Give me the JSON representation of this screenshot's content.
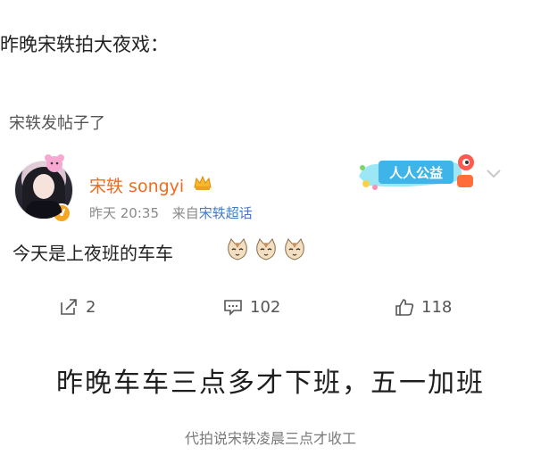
{
  "intro_title": "昨晚宋轶拍大夜戏：",
  "section_label": "宋轶发帖子了",
  "post": {
    "username": "宋轶 songyi",
    "time": "昨天 20:35",
    "source_prefix": "来自",
    "source_link": "宋轶超话",
    "verified_badge": "V",
    "text": "今天是上夜班的车车",
    "emoji_count": 3
  },
  "campaign_badge": "人人公益",
  "actions": {
    "repost_count": "2",
    "comment_count": "102",
    "like_count": "118"
  },
  "headline": "昨晚车车三点多才下班，五一加班",
  "caption": "代拍说宋轶凌晨三点才收工",
  "icons": [
    "pendant-icon",
    "crown-icon",
    "verified-icon",
    "cat-emoji-icon",
    "campaign-icon",
    "chevron-down-icon",
    "repost-icon",
    "comment-icon",
    "like-icon"
  ],
  "colors": {
    "username": "#f06b1f",
    "link": "#4a79c2",
    "badge": "#f5a623"
  }
}
